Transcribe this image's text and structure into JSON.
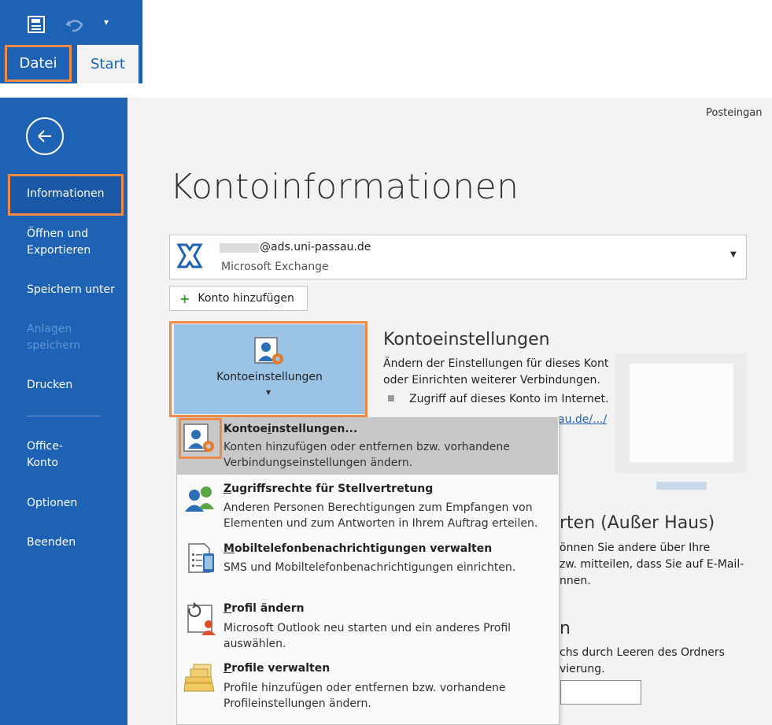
{
  "quick_access": {
    "items": [
      "save-icon",
      "undo-icon",
      "customize-icon"
    ]
  },
  "tabs": {
    "file": "Datei",
    "start": "Start"
  },
  "backstage": {
    "nav": {
      "info": "Informationen",
      "open_export_1": "Öffnen und",
      "open_export_2": "Exportieren",
      "save_as": "Speichern unter",
      "save_attachments_1": "Anlagen",
      "save_attachments_2": "speichern",
      "print": "Drucken",
      "office_account_1": "Office-",
      "office_account_2": "Konto",
      "options": "Optionen",
      "exit": "Beenden"
    },
    "top_right": "Posteingan",
    "page_title": "Kontoinformationen",
    "account": {
      "email": "@ads.uni-passau.de",
      "type": "Microsoft Exchange"
    },
    "add_account": "Konto hinzufügen",
    "account_settings_button": "Kontoeinstellungen",
    "account_settings_section": {
      "title": "Kontoeinstellungen",
      "line1": "Ändern der Einstellungen für dieses Kont",
      "line2": "oder Einrichten weiterer Verbindungen.",
      "bullet": "Zugriff auf dieses Konto im Internet.",
      "link": "au.de/.../"
    },
    "ooo_section": {
      "title": "rten (Außer Haus)",
      "line1": "önnen Sie andere über Ihre",
      "line2": "zw. mitteilen, dass Sie auf E-Mail-",
      "line3": "nnen."
    },
    "cleanup_section": {
      "title": "n",
      "line1": "chs durch Leeren des Ordners",
      "line2": "vierung."
    }
  },
  "menu": {
    "items": [
      {
        "title_pre": "Kontoe",
        "title_u": "i",
        "title_post": "nstellungen...",
        "desc1": "Konten hinzufügen oder entfernen bzw. vorhandene",
        "desc2": "Verbindungseinstellungen ändern."
      },
      {
        "title_pre": "",
        "title_u": "Z",
        "title_post": "ugriffsrechte für Stellvertretung",
        "desc1": "Anderen Personen Berechtigungen zum Empfangen von",
        "desc2": "Elementen und zum Antworten in Ihrem Auftrag erteilen."
      },
      {
        "title_pre": "",
        "title_u": "M",
        "title_post": "obiltelefonbenachrichtigungen verwalten",
        "desc1": "SMS und Mobiltelefonbenachrichtigungen einrichten.",
        "desc2": ""
      },
      {
        "title_pre": "",
        "title_u": "P",
        "title_post": "rofil ändern",
        "desc1": "Microsoft Outlook neu starten und ein anderes Profil",
        "desc2": "auswählen."
      },
      {
        "title_pre": "",
        "title_u": "P",
        "title_post": "rofile verwalten",
        "desc1": "Profile hinzufügen oder entfernen bzw. vorhandene",
        "desc2": "Profileinstellungen ändern."
      }
    ]
  },
  "colors": {
    "accent": "#1e62b5",
    "highlight_frame": "#f08a46",
    "button_fill": "#9bc3e6"
  }
}
